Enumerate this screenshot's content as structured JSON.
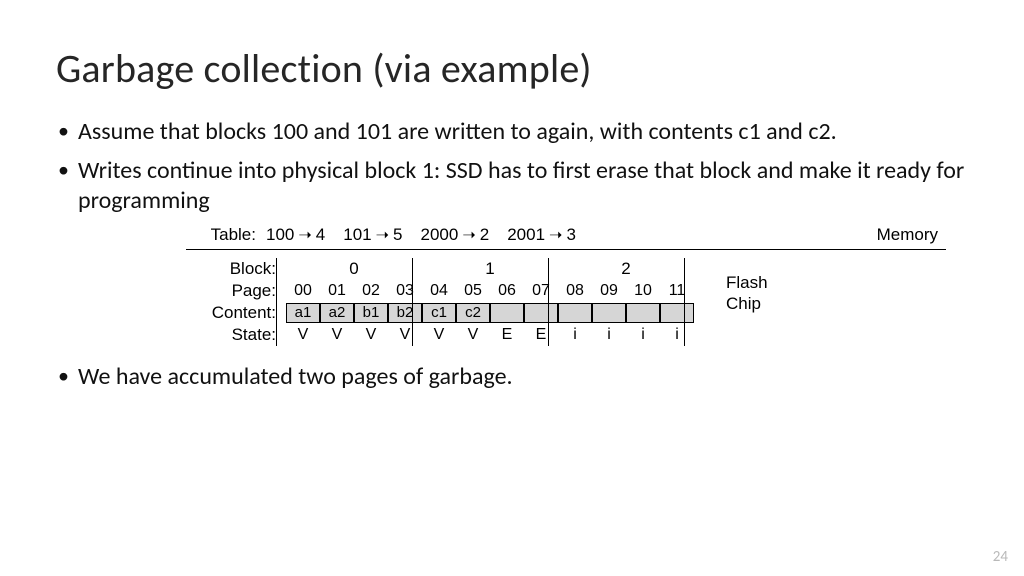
{
  "title": "Garbage collection (via example)",
  "bullets": [
    "Assume that blocks 100 and 101 are written to again, with contents c1 and c2.",
    "Writes continue into physical block 1: SSD has to first erase that block and make it ready for programming"
  ],
  "bullet_after": "We have accumulated two pages of garbage.",
  "table": {
    "label": "Table:",
    "mappings": [
      {
        "logical": "100",
        "physical": "4"
      },
      {
        "logical": "101",
        "physical": "5"
      },
      {
        "logical": "2000",
        "physical": "2"
      },
      {
        "logical": "2001",
        "physical": "3"
      }
    ],
    "side_label": "Memory"
  },
  "flash": {
    "block_label": "Block:",
    "page_label": "Page:",
    "content_label": "Content:",
    "state_label": "State:",
    "side_label_1": "Flash",
    "side_label_2": "Chip",
    "blocks": [
      "0",
      "1",
      "2"
    ],
    "pages": [
      "00",
      "01",
      "02",
      "03",
      "04",
      "05",
      "06",
      "07",
      "08",
      "09",
      "10",
      "11"
    ],
    "contents": [
      "a1",
      "a2",
      "b1",
      "b2",
      "c1",
      "c2",
      "",
      "",
      "",
      "",
      "",
      ""
    ],
    "states": [
      "V",
      "V",
      "V",
      "V",
      "V",
      "V",
      "E",
      "E",
      "i",
      "i",
      "i",
      "i"
    ]
  },
  "page_number": "24"
}
